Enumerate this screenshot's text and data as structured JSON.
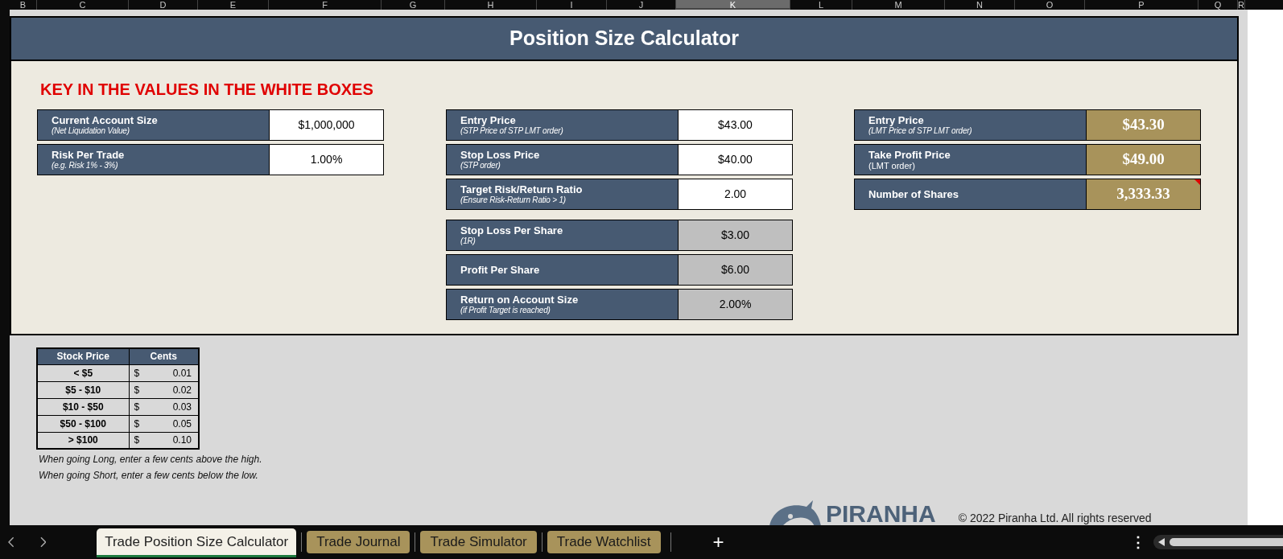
{
  "column_headers": [
    {
      "label": "B",
      "selected": false
    },
    {
      "label": "C",
      "selected": false
    },
    {
      "label": "D",
      "selected": false
    },
    {
      "label": "E",
      "selected": false
    },
    {
      "label": "F",
      "selected": false
    },
    {
      "label": "G",
      "selected": false
    },
    {
      "label": "H",
      "selected": false
    },
    {
      "label": "I",
      "selected": false
    },
    {
      "label": "J",
      "selected": false
    },
    {
      "label": "K",
      "selected": true
    },
    {
      "label": "L",
      "selected": false
    },
    {
      "label": "M",
      "selected": false
    },
    {
      "label": "N",
      "selected": false
    },
    {
      "label": "O",
      "selected": false
    },
    {
      "label": "P",
      "selected": false
    },
    {
      "label": "Q",
      "selected": false
    },
    {
      "label": "R",
      "selected": false
    }
  ],
  "title": "Position Size Calculator",
  "instruction": "KEY IN THE VALUES IN THE WHITE BOXES",
  "sections": [
    [
      {
        "kind": "input",
        "label": "Current Account Size",
        "note": "(Net Liquidation Value)",
        "value": "$1,000,000"
      },
      {
        "kind": "input",
        "label": "Risk Per Trade",
        "note": "(e.g. Risk 1% - 3%)",
        "value": "1.00%"
      }
    ],
    [
      {
        "kind": "input",
        "label": "Entry Price",
        "note": "(STP Price of STP LMT order)",
        "value": "$43.00"
      },
      {
        "kind": "input",
        "label": "Stop Loss Price",
        "note": "(STP order)",
        "value": "$40.00"
      },
      {
        "kind": "input",
        "label": "Target Risk/Return Ratio",
        "note": "(Ensure Risk-Return Ratio > 1)",
        "value": "2.00"
      },
      {
        "kind": "computed",
        "label": "Stop Loss Per Share",
        "note": "(1R)",
        "value": "$3.00"
      },
      {
        "kind": "computed",
        "label": "Profit Per Share",
        "value": "$6.00"
      },
      {
        "kind": "computed",
        "label": "Return on Account Size",
        "note": "(if Profit Target is reached)",
        "value": "2.00%"
      }
    ],
    [
      {
        "kind": "result",
        "label": "Entry Price",
        "note": "(LMT Price of STP LMT order)",
        "value": "$43.30",
        "has_comment": false
      },
      {
        "kind": "result",
        "label": "Take Profit Price",
        "subtitle": "(LMT order)",
        "value": "$49.00",
        "has_comment": false
      },
      {
        "kind": "result",
        "label": "Number of Shares",
        "value": "3,333.33",
        "has_comment": true
      }
    ]
  ],
  "tick_table": {
    "columns": [
      "Stock Price",
      "Cents"
    ],
    "rows": [
      {
        "price": "< $5",
        "currency": "$",
        "cents": "0.01"
      },
      {
        "price": "$5 - $10",
        "currency": "$",
        "cents": "0.02"
      },
      {
        "price": "$10 - $50",
        "currency": "$",
        "cents": "0.03"
      },
      {
        "price": "$50 - $100",
        "currency": "$",
        "cents": "0.05"
      },
      {
        "price": "> $100",
        "currency": "$",
        "cents": "0.10"
      }
    ]
  },
  "notes": [
    "When going Long, enter a few cents above the high.",
    "When going Short, enter a few cents below the low."
  ],
  "logo": "PIRANHA",
  "copyright": "© 2022 Piranha Ltd. All rights reserved",
  "sheet_tabs": [
    {
      "label": "Trade Position Size Calculator",
      "selected": true
    },
    {
      "label": "Trade Journal",
      "selected": false
    },
    {
      "label": "Trade Simulator",
      "selected": false
    },
    {
      "label": "Trade Watchlist",
      "selected": false
    }
  ],
  "add_sheet": "+",
  "more_menu": "⋮"
}
